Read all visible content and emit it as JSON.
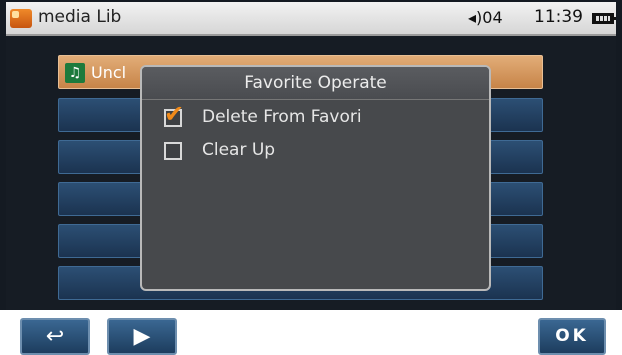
{
  "status_bar": {
    "app_icon": "media-library-icon",
    "title": "media Lib",
    "volume_icon": "speaker-icon",
    "volume": "04",
    "time": "11:39",
    "battery_icon": "battery-icon"
  },
  "list": {
    "selected_item": {
      "icon": "music-note-icon",
      "label": "Uncl"
    },
    "row_count": 6
  },
  "dialog": {
    "title": "Favorite Operate",
    "options": [
      {
        "label": "Delete From Favori",
        "checked": true
      },
      {
        "label": "Clear Up",
        "checked": false
      }
    ]
  },
  "bottom_bar": {
    "back_icon": "return-arrow-icon",
    "play_icon": "play-icon",
    "ok_label": "OK"
  },
  "colors": {
    "accent": "#f08a1a",
    "row_blue": "#2c4f74",
    "selected_row": "#e2ad78",
    "dialog_bg": "#47494c"
  }
}
